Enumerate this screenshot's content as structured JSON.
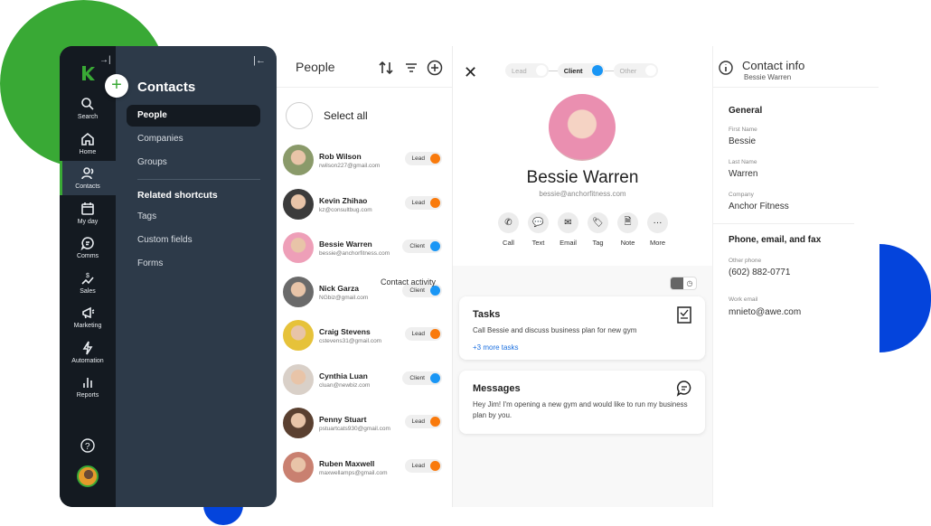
{
  "sidebar_rail": {
    "items": [
      {
        "id": "search",
        "label": "Search",
        "icon": "search-icon"
      },
      {
        "id": "home",
        "label": "Home",
        "icon": "home-icon"
      },
      {
        "id": "contacts",
        "label": "Contacts",
        "icon": "contacts-icon",
        "active": true
      },
      {
        "id": "myday",
        "label": "My day",
        "icon": "calendar-icon"
      },
      {
        "id": "comms",
        "label": "Comms",
        "icon": "chat-icon"
      },
      {
        "id": "sales",
        "label": "Sales",
        "icon": "sales-icon"
      },
      {
        "id": "marketing",
        "label": "Marketing",
        "icon": "megaphone-icon"
      },
      {
        "id": "automation",
        "label": "Automation",
        "icon": "lightning-icon"
      },
      {
        "id": "reports",
        "label": "Reports",
        "icon": "bar-chart-icon"
      }
    ],
    "brand_color": "#39a935"
  },
  "subnav": {
    "title": "Contacts",
    "items": [
      {
        "label": "People",
        "active": true
      },
      {
        "label": "Companies"
      },
      {
        "label": "Groups"
      }
    ],
    "section_title": "Related shortcuts",
    "shortcuts": [
      {
        "label": "Tags"
      },
      {
        "label": "Custom fields"
      },
      {
        "label": "Forms"
      }
    ]
  },
  "people_list": {
    "title": "People",
    "select_all_label": "Select all",
    "contact_activity_label": "Contact activity",
    "rows": [
      {
        "name": "Rob Wilson",
        "email": "rwilson227@gmail.com",
        "status": "Lead"
      },
      {
        "name": "Kevin Zhihao",
        "email": "kz@consultbug.com",
        "status": "Lead"
      },
      {
        "name": "Bessie Warren",
        "email": "bessie@anchorfitness.com",
        "status": "Client"
      },
      {
        "name": "Nick Garza",
        "email": "NGbiz@gmail.com",
        "status": "Client"
      },
      {
        "name": "Craig Stevens",
        "email": "cstevens31@gmail.com",
        "status": "Lead"
      },
      {
        "name": "Cynthia Luan",
        "email": "cluan@newbiz.com",
        "status": "Client"
      },
      {
        "name": "Penny Stuart",
        "email": "pstuartcats930@gmail.com",
        "status": "Lead"
      },
      {
        "name": "Ruben Maxwell",
        "email": "maxwellamps@gmail.com",
        "status": "Lead"
      }
    ],
    "status_colors": {
      "Lead": "#f97a0c",
      "Client": "#1a96f5"
    }
  },
  "detail": {
    "stages": [
      {
        "label": "Lead",
        "active": false
      },
      {
        "label": "Client",
        "active": true
      },
      {
        "label": "Other",
        "active": false
      }
    ],
    "name": "Bessie Warren",
    "email": "bessie@anchorfitness.com",
    "actions": [
      {
        "label": "Call",
        "glyph": "✆"
      },
      {
        "label": "Text",
        "glyph": "💬"
      },
      {
        "label": "Email",
        "glyph": "✉"
      },
      {
        "label": "Tag",
        "glyph": "🏷"
      },
      {
        "label": "Note",
        "glyph": "🗎"
      },
      {
        "label": "More",
        "glyph": "···"
      }
    ],
    "tasks": {
      "title": "Tasks",
      "body": "Call Bessie and discuss business plan for new gym",
      "link": "+3 more tasks"
    },
    "messages": {
      "title": "Messages",
      "body": "Hey Jim! I'm opening a new gym and would like to run my business plan by you."
    }
  },
  "contact_info": {
    "title": "Contact info",
    "subtitle": "Bessie Warren",
    "general_title": "General",
    "fields_general": [
      {
        "label": "First Name",
        "value": "Bessie"
      },
      {
        "label": "Last Name",
        "value": "Warren"
      },
      {
        "label": "Company",
        "value": "Anchor Fitness"
      }
    ],
    "phone_title": "Phone, email, and fax",
    "fields_phone": [
      {
        "label": "Other phone",
        "value": "(602) 882-0771"
      },
      {
        "label": "Work email",
        "value": "mnieto@awe.com"
      }
    ]
  }
}
